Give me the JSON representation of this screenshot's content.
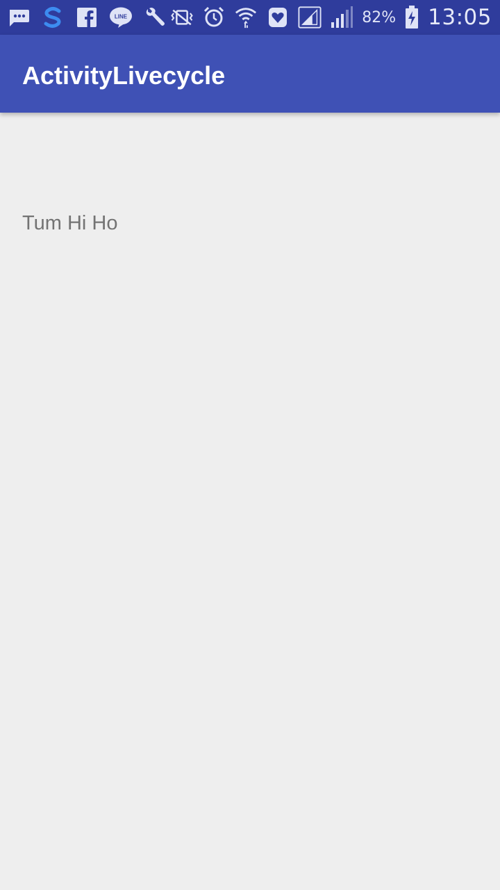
{
  "status_bar": {
    "left_icons": [
      "messages-icon",
      "browser-s-icon",
      "facebook-icon",
      "line-icon",
      "wrench-icon"
    ],
    "right_icons": [
      "vibrate-icon",
      "alarm-icon",
      "wifi-icon",
      "health-icon",
      "signal-1-icon",
      "signal-2-icon",
      "battery-charging-icon"
    ],
    "battery_percent": "82%",
    "time": "13:05",
    "colors": {
      "background": "#2f3c9c",
      "icon": "#dfe3f6"
    }
  },
  "app_bar": {
    "title": "ActivityLivecycle",
    "color": "#3f51b5"
  },
  "content": {
    "text": "Tum Hi Ho"
  }
}
